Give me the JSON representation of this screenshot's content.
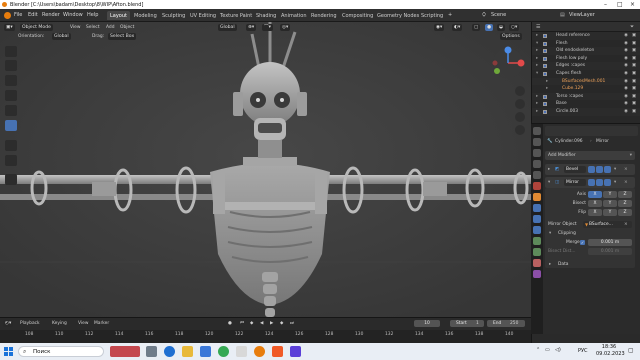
{
  "window_title": "Blender [C:\\Users\\badam\\Desktop\\8\\WIP\\Afton.blend]",
  "menu": [
    "File",
    "Edit",
    "Render",
    "Window",
    "Help"
  ],
  "workspaces": [
    "Layout",
    "Modeling",
    "Sculpting",
    "UV Editing",
    "Texture Paint",
    "Shading",
    "Animation",
    "Rendering",
    "Compositing",
    "Geometry Nodes",
    "Scripting"
  ],
  "active_workspace": "Layout",
  "scene_label": "Scene",
  "viewlayer_label": "ViewLayer",
  "viewport": {
    "mode": "Object Mode",
    "menus": [
      "View",
      "Select",
      "Add",
      "Object"
    ],
    "transform": "Global",
    "orientation_label": "Orientation:",
    "orientation_value": "Global",
    "drag_label": "Drag:",
    "drag_value": "Select Box",
    "options_label": "Options"
  },
  "outliner": {
    "rows": [
      {
        "name": "Head reference",
        "expanded": false
      },
      {
        "name": "Flesh",
        "expanded": true
      },
      {
        "name": "Old endoskeleton",
        "expanded": false
      },
      {
        "name": "Flesh low poly",
        "expanded": false
      },
      {
        "name": "Edges :capes",
        "expanded": false
      },
      {
        "name": "Capes flesh",
        "expanded": true
      },
      {
        "name": "BSurfacesMesh.001",
        "expanded": false
      },
      {
        "name": "Cube.129",
        "expanded": false
      },
      {
        "name": "Torso :capes",
        "expanded": false
      },
      {
        "name": "Base",
        "expanded": false
      },
      {
        "name": "Circle.003",
        "expanded": false
      }
    ]
  },
  "properties": {
    "object_name": "Cylinder.096",
    "modifier_name": "Mirror",
    "add_modifier_label": "Add Modifier",
    "modifiers": [
      "Bevel",
      "Mirror"
    ],
    "axis_label": "Axis",
    "bisect_label": "Bisect",
    "flip_label": "Flip",
    "axes": [
      "X",
      "Y",
      "Z"
    ],
    "mirror_object_label": "Mirror Object",
    "mirror_object_value": "BSurface...",
    "clipping_label": "Clipping",
    "merge_label": "Merge",
    "merge_value": "0.001 m",
    "bisect_distance_label": "Bisect Dist...",
    "bisect_distance_value": "0.001 m",
    "data_label": "Data"
  },
  "timeline": {
    "menus": [
      "Playback",
      "Keying",
      "View",
      "Marker"
    ],
    "current_frame": "10",
    "start_label": "Start",
    "start_value": "1",
    "end_label": "End",
    "end_value": "250",
    "ticks": [
      "108",
      "110",
      "112",
      "114",
      "116",
      "118",
      "120",
      "122",
      "124",
      "126",
      "128",
      "130",
      "132",
      "134",
      "136",
      "138",
      "140"
    ]
  },
  "taskbar": {
    "search_placeholder": "Поиск",
    "language": "РУС",
    "time": "18:36",
    "date": "09.02.2023"
  },
  "colors": {
    "accent": "#4772b3",
    "blender_orange": "#e87d0d",
    "viewport_bg": "#3d3d3d"
  }
}
